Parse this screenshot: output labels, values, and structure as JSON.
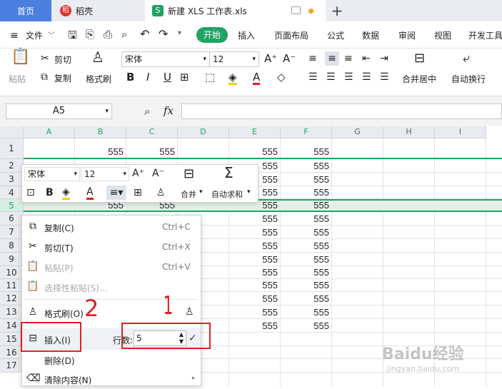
{
  "tabs": {
    "home": "首页",
    "daoke": "稻壳",
    "doc": "新建 XLS 工作表.xls",
    "add": "+"
  },
  "menu": {
    "file": "文件",
    "items": [
      "开始",
      "插入",
      "页面布局",
      "公式",
      "数据",
      "审阅",
      "视图",
      "开发工具"
    ]
  },
  "ribbon": {
    "paste": "粘贴",
    "cut": "剪切",
    "copy": "复制",
    "format_painter": "格式刷",
    "font": "宋体",
    "size": "12",
    "merge": "合并居中",
    "wrap": "自动换行"
  },
  "formula_bar": {
    "cell_ref": "A5",
    "fx": "fx"
  },
  "columns": [
    "A",
    "B",
    "C",
    "D",
    "E",
    "F",
    "G",
    "H",
    "I"
  ],
  "rows": [
    "1",
    "2",
    "3",
    "4",
    "5",
    "6",
    "7",
    "8",
    "9",
    "10",
    "11",
    "12",
    "13",
    "14",
    "15",
    "16",
    "17"
  ],
  "cell_value": "555",
  "minibar": {
    "font": "宋体",
    "size": "12",
    "merge": "合并",
    "autosum": "自动求和"
  },
  "context_menu": {
    "copy": "复制(C)",
    "copy_sc": "Ctrl+C",
    "cut": "剪切(T)",
    "cut_sc": "Ctrl+X",
    "paste": "粘贴(P)",
    "paste_sc": "Ctrl+V",
    "paste_special": "选择性粘贴(S)...",
    "format_painter": "格式刷(O)",
    "insert": "插入(I)",
    "rows_label": "行数:",
    "rows_value": "5",
    "delete": "删除(D)",
    "clear": "清除内容(N)"
  },
  "annotations": {
    "one": "1",
    "two": "2"
  },
  "watermark": {
    "line1": "Baidu经验",
    "line2": "jingyan.baidu.com"
  },
  "colors": {
    "accent": "#21a366",
    "red": "#e02020",
    "green_tab": "#21a366"
  }
}
